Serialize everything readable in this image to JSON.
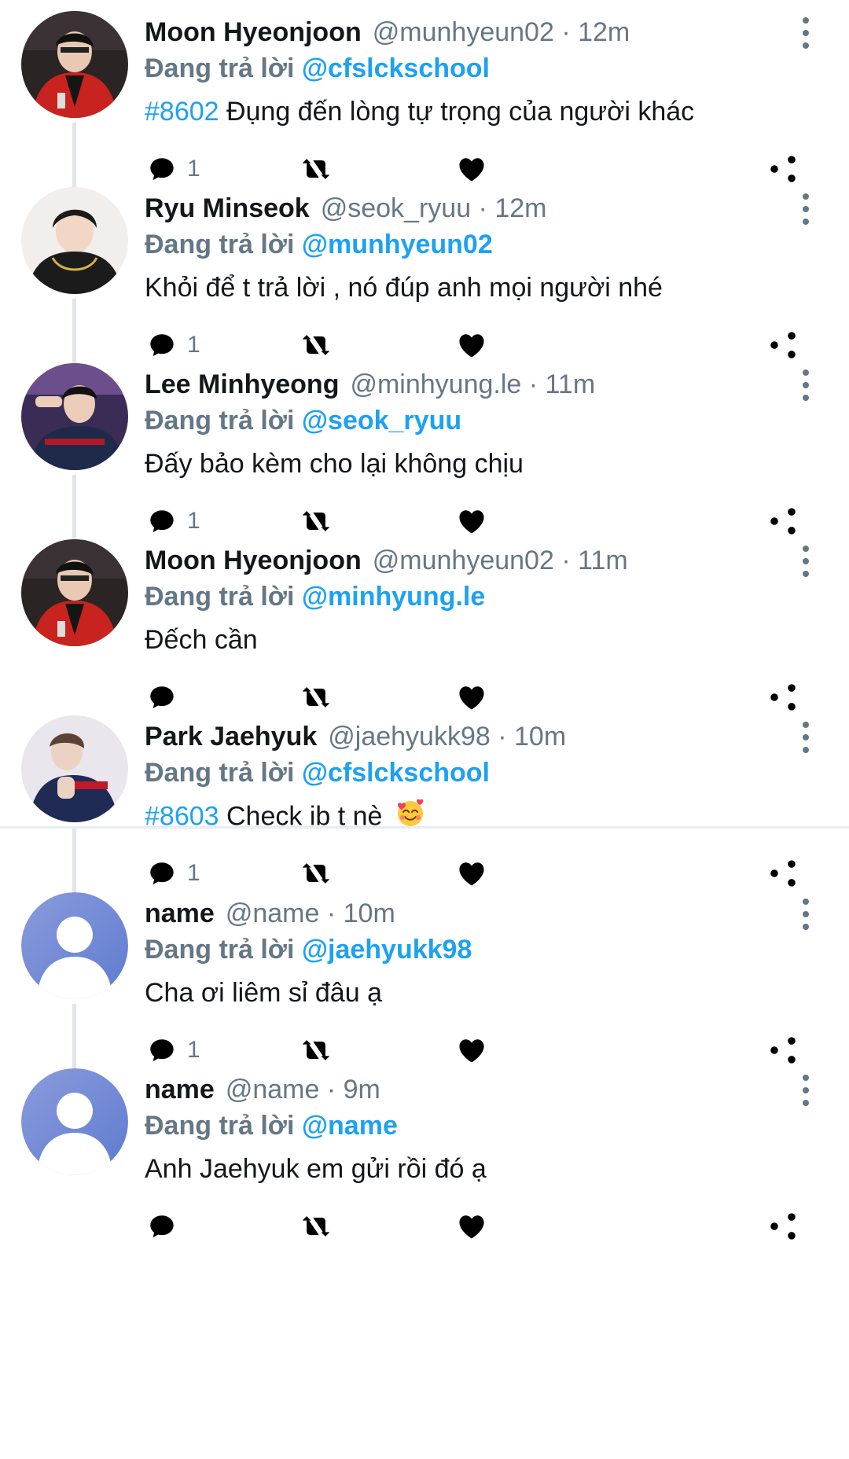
{
  "reply_prefix": "Đang trả lời",
  "colors": {
    "link": "#1da1f2",
    "secondary": "#657786",
    "primary": "#14171a"
  },
  "icons": {
    "reply": "comment-icon",
    "retweet": "retweet-icon",
    "like": "heart-icon",
    "views": "analytics-icon",
    "share": "share-icon",
    "more": "more-vertical-icon"
  },
  "tweets": [
    {
      "name": "Moon Hyeonjoon",
      "handle": "@munhyeun02",
      "time": "12m",
      "reply_to": "@cfslckschool",
      "hashtag": "#8602",
      "text": "Đụng đến lòng tự trọng của người khác",
      "reply_count": "1",
      "avatar": "red-jacket-photo"
    },
    {
      "name": "Ryu Minseok",
      "handle": "@seok_ryuu",
      "time": "12m",
      "reply_to": "@munhyeun02",
      "hashtag": "",
      "text": "Khỏi để t trả lời , nó đúp anh mọi người nhé",
      "reply_count": "1",
      "avatar": "black-hoodie-photo"
    },
    {
      "name": "Lee Minhyeong",
      "handle": "@minhyung.le",
      "time": "11m",
      "reply_to": "@seok_ryuu",
      "hashtag": "",
      "text": "Đấy bảo kèm cho lại không chịu",
      "reply_count": "1",
      "avatar": "team-jacket-photo"
    },
    {
      "name": "Moon Hyeonjoon",
      "handle": "@munhyeun02",
      "time": "11m",
      "reply_to": "@minhyung.le",
      "hashtag": "",
      "text": "Đếch cần",
      "reply_count": "",
      "avatar": "red-jacket-photo"
    },
    {
      "name": "Park Jaehyuk",
      "handle": "@jaehyukk98",
      "time": "10m",
      "reply_to": "@cfslckschool",
      "hashtag": "#8603",
      "text": "Check ib t nè",
      "reply_count": "1",
      "avatar": "navy-jacket-photo",
      "emoji": "smiling-face-with-hearts"
    },
    {
      "name": "name",
      "handle": "@name",
      "time": "10m",
      "reply_to": "@jaehyukk98",
      "hashtag": "",
      "text": "Cha ơi liêm sỉ đâu ạ",
      "reply_count": "1",
      "avatar": "default-avatar"
    },
    {
      "name": "name",
      "handle": "@name",
      "time": "9m",
      "reply_to": "@name",
      "hashtag": "",
      "text": "Anh Jaehyuk em gửi rồi đó ạ",
      "reply_count": "",
      "avatar": "default-avatar"
    }
  ]
}
